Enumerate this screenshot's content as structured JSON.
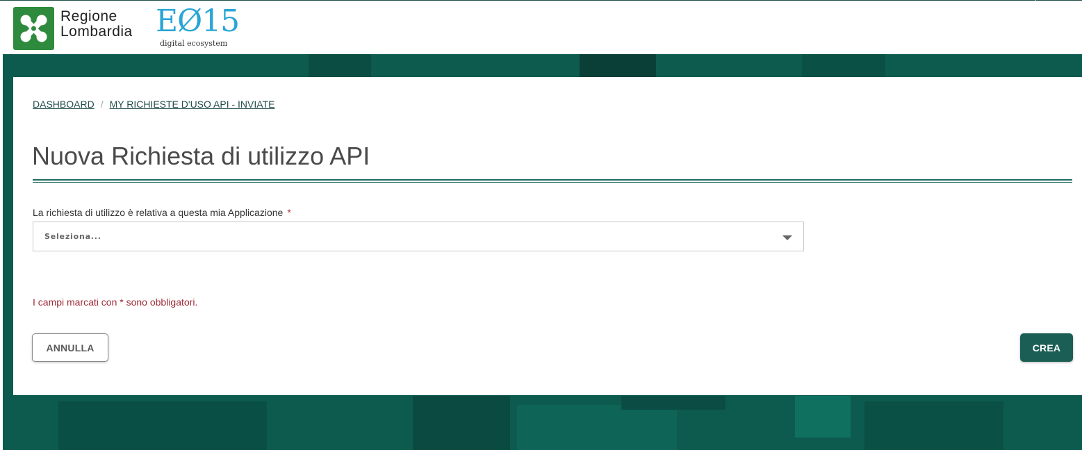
{
  "header": {
    "logo_line1": "Regione",
    "logo_line2": "Lombardia",
    "brand_mark": "EØ15",
    "brand_sub": "digital ecosystem"
  },
  "breadcrumb": {
    "items": [
      {
        "label": "DASHBOARD"
      },
      {
        "label": "MY RICHIESTE D'USO API - INVIATE"
      }
    ],
    "separator": "/"
  },
  "page": {
    "title": "Nuova Richiesta di utilizzo API"
  },
  "form": {
    "application_label": "La richiesta di utilizzo è relativa a questa mia Applicazione",
    "required_marker": "*",
    "application_placeholder": "Seleziona...",
    "required_note": "I campi marcati con * sono obbligatori."
  },
  "actions": {
    "cancel_label": "ANNULLA",
    "create_label": "CREA"
  },
  "colors": {
    "brand_green": "#2e8b3e",
    "brand_blue": "#2aa5d6",
    "background_teal": "#0d5b4f",
    "primary_button": "#1b5e55",
    "required_red": "#9c2a35"
  },
  "icons": {
    "logo": "regione-lombardia-rosa-camuna-icon",
    "dropdown": "chevron-down-icon"
  }
}
